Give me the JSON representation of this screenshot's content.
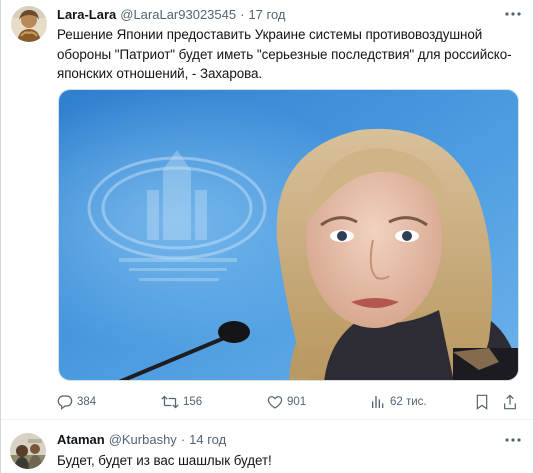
{
  "tweets": [
    {
      "display_name": "Lara-Lara",
      "handle": "@LaraLar93023545",
      "separator": "·",
      "time": "17 год",
      "text": "Решение Японии предоставить Украине системы противовоздушной обороны \"Патриот\" будет иметь \"серьезные последствия\" для российско-японских отношений, - Захарова.",
      "actions": {
        "replies": "384",
        "retweets": "156",
        "likes": "901",
        "views": "62 тис."
      },
      "icons": [
        "reply-icon",
        "retweet-icon",
        "like-icon",
        "views-icon",
        "bookmark-icon",
        "share-icon"
      ]
    },
    {
      "display_name": "Ataman",
      "handle": "@Kurbashy",
      "separator": "·",
      "time": "14 год",
      "text": "Будет, будет из вас шашлык будет!"
    }
  ],
  "colors": {
    "text": "#0f1419",
    "secondary": "#536471",
    "photo_backdrop": "#3f90d6"
  }
}
